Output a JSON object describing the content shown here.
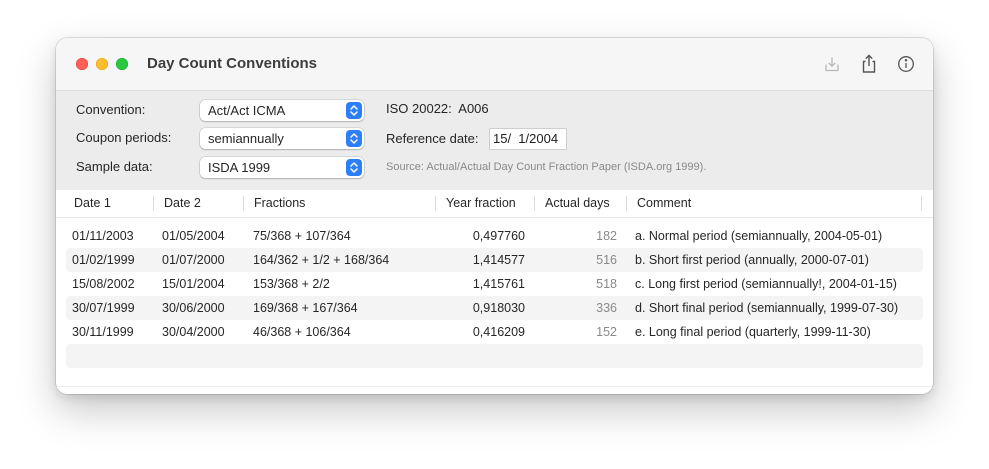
{
  "window": {
    "title": "Day Count Conventions"
  },
  "toolbar": {
    "icons": [
      "download-icon",
      "share-icon",
      "info-icon"
    ]
  },
  "form": {
    "convention_label": "Convention:",
    "convention_value": "Act/Act ICMA",
    "coupon_label": "Coupon periods:",
    "coupon_value": "semiannually",
    "sample_label": "Sample data:",
    "sample_value": "ISDA 1999",
    "iso_text": "ISO 20022:  A006",
    "reference_label": "Reference date:",
    "reference_value": "15/  1/2004",
    "source_note": "Source: Actual/Actual Day Count Fraction Paper (ISDA.org 1999)."
  },
  "table": {
    "columns": [
      "Date 1",
      "Date 2",
      "Fractions",
      "Year fraction",
      "Actual days",
      "Comment"
    ],
    "rows": [
      {
        "date1": "01/11/2003",
        "date2": "01/05/2004",
        "fractions": "75/368 + 107/364",
        "year_fraction": "0,497760",
        "actual_days": "182",
        "comment": "a. Normal period (semiannually, 2004-05-01)"
      },
      {
        "date1": "01/02/1999",
        "date2": "01/07/2000",
        "fractions": "164/362 + 1/2 + 168/364",
        "year_fraction": "1,414577",
        "actual_days": "516",
        "comment": "b. Short first period (annually, 2000-07-01)"
      },
      {
        "date1": "15/08/2002",
        "date2": "15/01/2004",
        "fractions": "153/368 + 2/2",
        "year_fraction": "1,415761",
        "actual_days": "518",
        "comment": "c. Long first period (semiannually!, 2004-01-15)"
      },
      {
        "date1": "30/07/1999",
        "date2": "30/06/2000",
        "fractions": "169/368 + 167/364",
        "year_fraction": "0,918030",
        "actual_days": "336",
        "comment": "d. Short final period (semiannually, 1999-07-30)"
      },
      {
        "date1": "30/11/1999",
        "date2": "30/04/2000",
        "fractions": "46/368 + 106/364",
        "year_fraction": "0,416209",
        "actual_days": "152",
        "comment": "e. Long final period (quarterly, 1999-11-30)"
      }
    ]
  },
  "colors": {
    "accent": "#2d7ff9",
    "close": "#ff5f57",
    "minimize": "#febc2e",
    "maximize": "#28c840"
  }
}
